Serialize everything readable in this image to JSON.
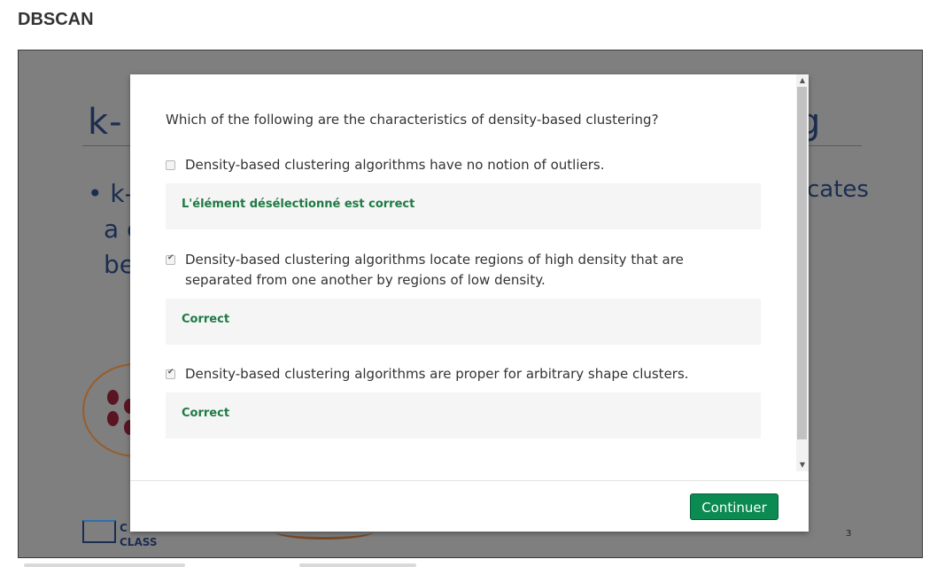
{
  "page": {
    "title": "DBSCAN"
  },
  "slide": {
    "title_visible": "k-",
    "title_tail": "g",
    "bullet_lines": [
      "• k-",
      "a c",
      "be"
    ],
    "bullet_tail": "cates",
    "paren": ")",
    "logo_text_1": "C",
    "logo_text_2": "CLASS",
    "slide_number": "3"
  },
  "quiz": {
    "question": "Which of the following are the characteristics of density-based clustering?",
    "options": [
      {
        "label": "Density-based clustering algorithms have no notion of outliers.",
        "checked": false,
        "feedback": "L'élément désélectionné est correct"
      },
      {
        "label": "Density-based clustering algorithms locate regions of high density that are separated from one another by regions of low density.",
        "checked": true,
        "feedback": "Correct"
      },
      {
        "label": "Density-based clustering algorithms are proper for arbitrary shape clusters.",
        "checked": true,
        "feedback": "Correct"
      }
    ],
    "continue_label": "Continuer"
  },
  "colors": {
    "accent_button": "#0b8a52",
    "feedback_text": "#1e7a43",
    "overlay": "#7f7f7f"
  },
  "icons": {
    "scroll_up": "arrow-up-icon",
    "scroll_down": "arrow-down-icon",
    "checkbox_checked": "check-icon"
  }
}
